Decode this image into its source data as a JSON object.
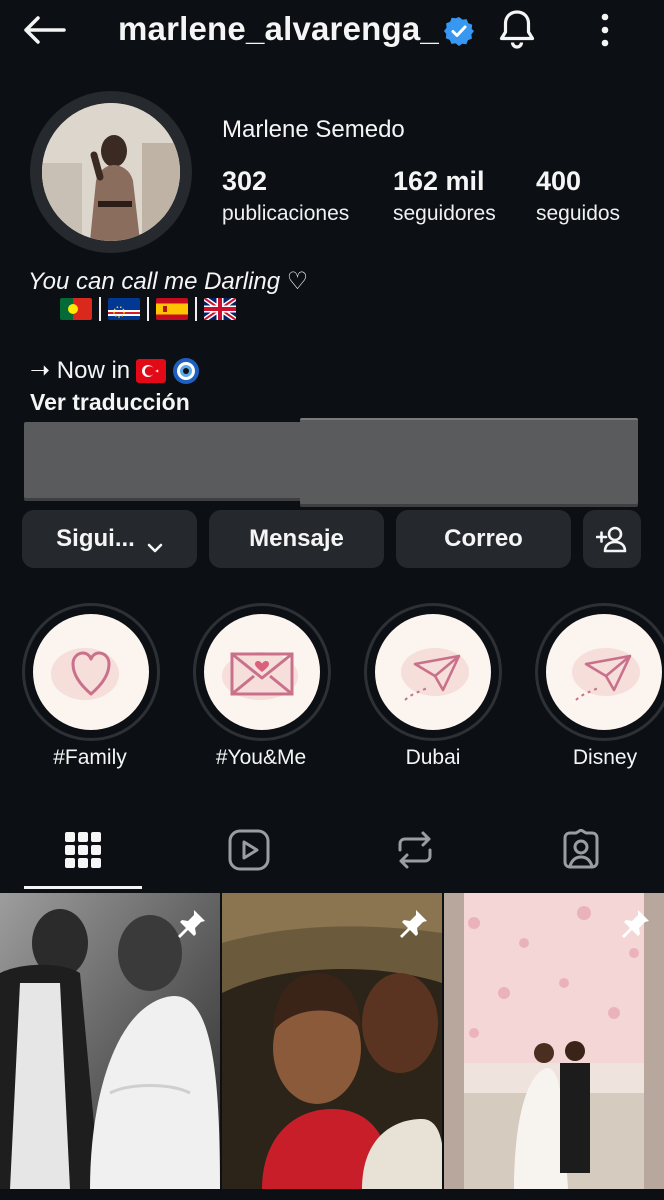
{
  "header": {
    "username": "marlene_alvarenga_",
    "verified_icon": "verified-badge-icon",
    "icons": [
      "back-arrow-icon",
      "bell-icon",
      "more-vertical-icon"
    ]
  },
  "profile": {
    "name": "Marlene Semedo",
    "stats": [
      {
        "value": "302",
        "label": "publicaciones"
      },
      {
        "value": "162 mil",
        "label": "seguidores"
      },
      {
        "value": "400",
        "label": "seguidos"
      }
    ],
    "bio_line1": "You can call me Darling ♡",
    "flags": [
      "flag-portugal",
      "flag-cape-verde",
      "flag-spain",
      "flag-uk"
    ],
    "bio_line2": "➝ Now in",
    "bio_line2_emojis": [
      "flag-turkey",
      "nazar-amulet"
    ],
    "translate": "Ver traducción"
  },
  "actions": {
    "follow": "Sigui...",
    "message": "Mensaje",
    "email": "Correo",
    "add_person_icon": "add-person-icon"
  },
  "highlights": [
    {
      "label": "#Family",
      "icon": "heart-icon"
    },
    {
      "label": "#You&Me",
      "icon": "love-letter-icon"
    },
    {
      "label": "Dubai",
      "icon": "paper-plane-icon"
    },
    {
      "label": "Disney",
      "icon": "paper-plane-icon"
    }
  ],
  "tabs": [
    "grid-icon",
    "reels-icon",
    "reposts-icon",
    "tagged-icon"
  ],
  "colors": {
    "background": "#0c1014",
    "button": "#25292e",
    "verified": "#3897f0",
    "highlight_bg": "#fbf4ef",
    "highlight_accent": "#d98aa0"
  }
}
